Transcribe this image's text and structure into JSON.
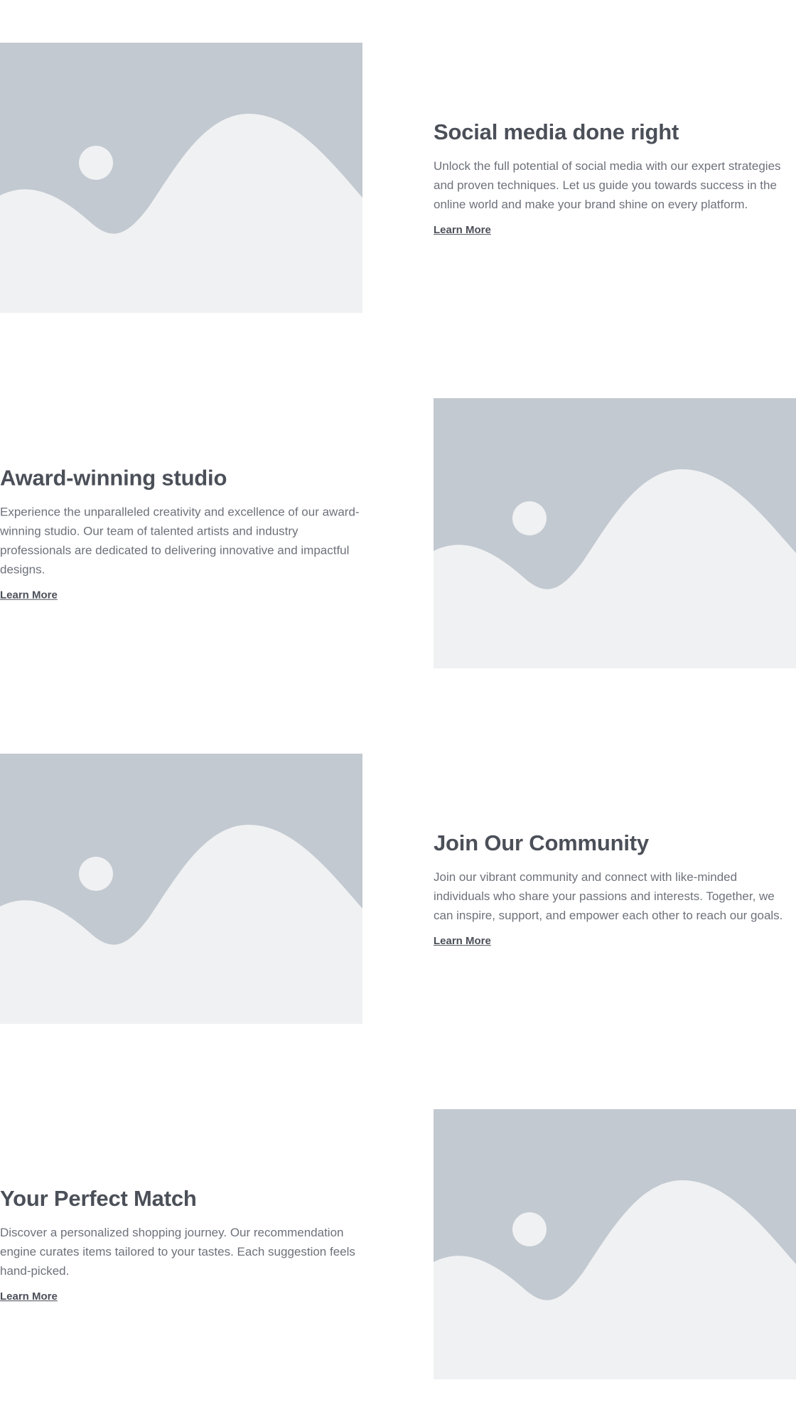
{
  "colors": {
    "image_bg": "#c2c9d0",
    "image_shape": "#f0f1f3",
    "heading": "#4b4f58",
    "body": "#6d717a"
  },
  "features": [
    {
      "image_icon": "image-placeholder-icon",
      "title": "Social media done right",
      "description": "Unlock the full potential of social media with our expert strategies and proven techniques. Let us guide you towards success in the online world and make your brand shine on every platform.",
      "link_label": "Learn More"
    },
    {
      "image_icon": "image-placeholder-icon",
      "title": "Award-winning studio",
      "description": "Experience the unparalleled creativity and excellence of our award-winning studio. Our team of talented artists and industry professionals are dedicated to delivering innovative and impactful designs.",
      "link_label": "Learn More"
    },
    {
      "image_icon": "image-placeholder-icon",
      "title": "Join Our Community",
      "description": "Join our vibrant community and connect with like-minded individuals who share your passions and interests. Together, we can inspire, support, and empower each other to reach our goals.",
      "link_label": "Learn More"
    },
    {
      "image_icon": "image-placeholder-icon",
      "title": "Your Perfect Match",
      "description": "Discover a personalized shopping journey. Our recommendation engine curates items tailored to your tastes. Each suggestion feels hand-picked.",
      "link_label": "Learn More"
    }
  ]
}
